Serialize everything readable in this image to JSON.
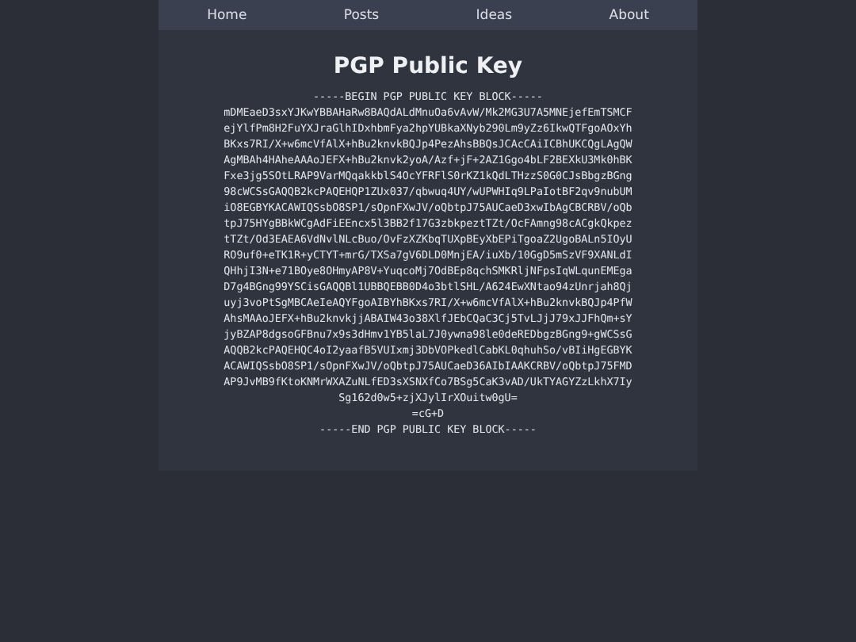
{
  "nav": [
    {
      "label": "Home"
    },
    {
      "label": "Posts"
    },
    {
      "label": "Ideas"
    },
    {
      "label": "About"
    }
  ],
  "title": "PGP Public Key",
  "key_lines": [
    "-----BEGIN PGP PUBLIC KEY BLOCK-----",
    "mDMEaeD3sxYJKwYBBAHaRw8BAQdALdMnuOa6vAvW/Mk2MG3U7A5MNEjefEmTSMCF",
    "ejYlfPm8H2FuYXJraGlhIDxhbmFya2hpYUBkaXNyb290Lm9yZz6IkwQTFgoAOxYh",
    "BKxs7RI/X+w6mcVfAlX+hBu2knvkBQJp4PezAhsBBQsJCAcCAiICBhUKCQgLAgQW",
    "AgMBAh4HAheAAAoJEFX+hBu2knvk2yoA/Azf+jF+2AZ1Ggo4bLF2BEXkU3Mk0hBK",
    "Fxe3jg5SOtLRAP9VarMQqakkblS4OcYFRFlS0rKZ1kQdLTHzzS0G0CJsBbgzBGng",
    "98cWCSsGAQQB2kcPAQEHQP1ZUx037/qbwuq4UY/wUPWHIq9LPaIotBF2qv9nubUM",
    "iO8EGBYKACAWIQSsbO8SP1/sOpnFXwJV/oQbtpJ75AUCaeD3xwIbAgCBCRBV/oQb",
    "tpJ75HYgBBkWCgAdFiEEncx5l3BB2f17G3zbkpeztTZt/OcFAmng98cACgkQkpez",
    "tTZt/Od3EAEA6VdNvlNLcBuo/OvFzXZKbqTUXpBEyXbEPiTgoaZ2UgoBALn5IOyU",
    "RO9uf0+eTK1R+yCTYT+mrG/TXSa7gV6DLD0MnjEA/iuXb/10GgD5mSzVF9XANLdI",
    "QHhjI3N+e71BOye8OHmyAP8V+YuqcoMj7OdBEp8qchSMKRljNFpsIqWLqunEMEga",
    "D7g4BGng99YSCisGAQQBl1UBBQEBB0D4o3btlSHL/A624EwXNtao94zUnrjah8Qj",
    "uyj3voPtSgMBCAeIeAQYFgoAIBYhBKxs7RI/X+w6mcVfAlX+hBu2knvkBQJp4PfW",
    "AhsMAAoJEFX+hBu2knvkjjABAIW43o38XlfJEbCQaC3Cj5TvLJjJ79xJJFhQm+sY",
    "jyBZAP8dgsoGFBnu7x9s3dHmv1YB5laL7J0ywna98le0deREDbgzBGng9+gWCSsG",
    "AQQB2kcPAQEHQC4oI2yaafB5VUIxmj3DbVOPkedlCabKL0qhuhSo/vBIiHgEGBYK",
    "ACAWIQSsbO8SP1/sOpnFXwJV/oQbtpJ75AUCaeD36AIbIAAKCRBV/oQbtpJ75FMD",
    "AP9JvMB9fKtoKNMrWXAZuNLfED3sXSNXfCo7BSg5CaK3vAD/UkTYAGYZzLkhX7Iy",
    "Sg162d0w5+zjXJylIrXOuitw0gU=",
    "=cG+D",
    "-----END PGP PUBLIC KEY BLOCK-----"
  ]
}
